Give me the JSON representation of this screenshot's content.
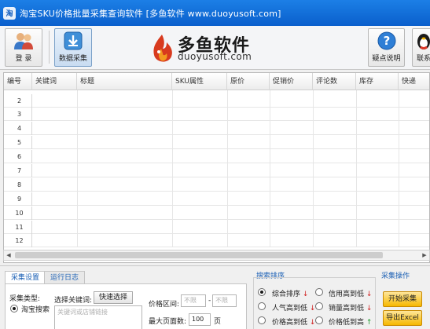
{
  "window": {
    "title": "淘宝SKU价格批量采集查询软件 [多鱼软件 www.duoyusoft.com]",
    "icon_text": "淘"
  },
  "toolbar": {
    "login_label": "登 录",
    "collect_label": "数据采集",
    "help_label": "疑点说明",
    "contact_label": "联系"
  },
  "logo": {
    "cn": "多鱼软件",
    "en": "duoyusoft.com"
  },
  "grid": {
    "columns": [
      "编号",
      "关键词",
      "标题",
      "SKU属性",
      "原价",
      "促销价",
      "评论数",
      "库存",
      "快递"
    ],
    "row_numbers": [
      "2",
      "3",
      "4",
      "5",
      "6",
      "7",
      "8",
      "9",
      "10",
      "11",
      "12"
    ]
  },
  "tabs": [
    {
      "label": "采集设置"
    },
    {
      "label": "运行日志"
    }
  ],
  "settings": {
    "collect_type_label": "采集类型:",
    "collect_type_option": "淘宝搜索",
    "keyword_label": "选择关键词:",
    "quick_select_label": "快速选择",
    "keyword_placeholder": "关键词或店铺链接",
    "price_range_label": "价格区间:",
    "price_min_placeholder": "不限",
    "price_dash": "-",
    "price_max_placeholder": "不限",
    "max_pages_label": "最大页面数:",
    "max_pages_value": "100",
    "pages_unit": "页"
  },
  "sort": {
    "title": "搜索排序",
    "options": [
      {
        "label": "综合排序",
        "dir": "down",
        "selected": true
      },
      {
        "label": "信用高到低",
        "dir": "down",
        "selected": false
      },
      {
        "label": "人气高到低",
        "dir": "down",
        "selected": false
      },
      {
        "label": "销量高到低",
        "dir": "down",
        "selected": false
      },
      {
        "label": "价格高到低",
        "dir": "down",
        "selected": false
      },
      {
        "label": "价格低到高",
        "dir": "up",
        "selected": false
      }
    ]
  },
  "operations": {
    "title": "采集操作",
    "start_label": "开始采集",
    "export_label": "导出Excel"
  },
  "colors": {
    "titlebar": "#0a5fcc",
    "accent_blue": "#1a5fb4",
    "button_orange": "#f6b800"
  }
}
